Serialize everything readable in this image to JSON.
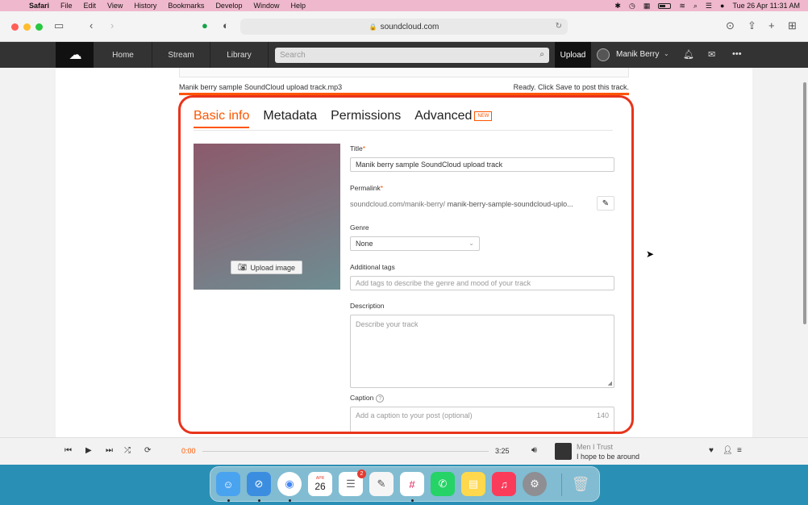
{
  "menubar": {
    "app": "Safari",
    "items": [
      "File",
      "Edit",
      "View",
      "History",
      "Bookmarks",
      "Develop",
      "Window",
      "Help"
    ],
    "datetime": "Tue 26 Apr  11:31 AM"
  },
  "browser": {
    "url": "soundcloud.com"
  },
  "header": {
    "nav": [
      "Home",
      "Stream",
      "Library"
    ],
    "search_placeholder": "Search",
    "upload": "Upload",
    "username": "Manik Berry"
  },
  "upload": {
    "filename": "Manik berry sample SoundCloud upload track.mp3",
    "status": "Ready. Click Save to post this track.",
    "progress": 1.0
  },
  "tabs": [
    "Basic info",
    "Metadata",
    "Permissions",
    "Advanced"
  ],
  "active_tab": "Basic info",
  "new_badge": "NEW",
  "form": {
    "upload_image": "Upload image",
    "title_label": "Title",
    "title_value": "Manik berry sample SoundCloud upload track",
    "permalink_label": "Permalink",
    "permalink_base": "soundcloud.com/manik-berry/",
    "permalink_slug": "manik-berry-sample-soundcloud-uplo...",
    "genre_label": "Genre",
    "genre_value": "None",
    "tags_label": "Additional tags",
    "tags_placeholder": "Add tags to describe the genre and mood of your track",
    "description_label": "Description",
    "description_placeholder": "Describe your track",
    "caption_label": "Caption",
    "caption_placeholder": "Add a caption to your post (optional)",
    "caption_count": "140"
  },
  "player": {
    "elapsed": "0:00",
    "total": "3:25",
    "artist": "Men I Trust",
    "title": "I hope to be around"
  },
  "dock": {
    "calendar_month": "APR",
    "calendar_day": "26",
    "reminders_badge": "2"
  },
  "colors": {
    "accent": "#ff5500",
    "highlight_border": "#e8341c"
  }
}
